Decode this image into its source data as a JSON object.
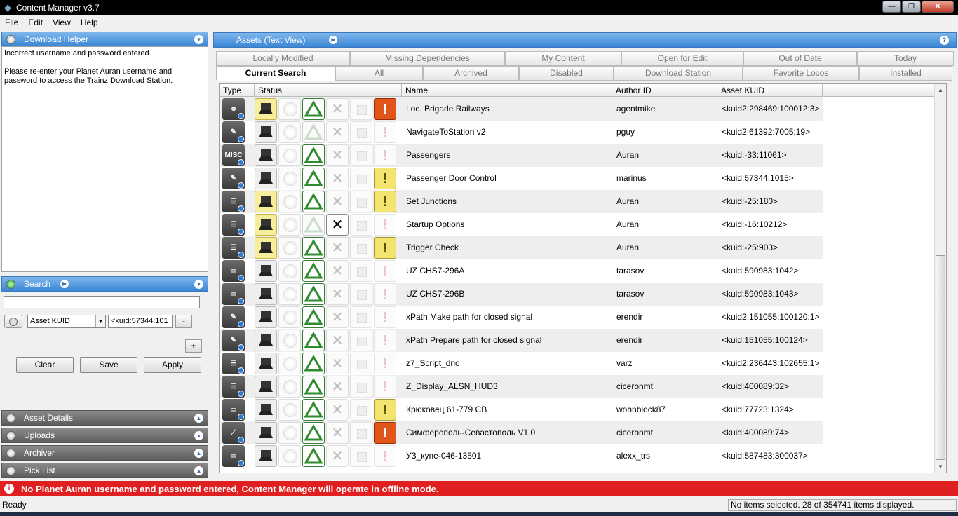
{
  "window": {
    "title": "Content Manager v3.7",
    "min": "—",
    "max": "❐",
    "close": "✕"
  },
  "menu": [
    "File",
    "Edit",
    "View",
    "Help"
  ],
  "download_helper": {
    "title": "Download Helper",
    "message1": "Incorrect username and password entered.",
    "message2": "Please re-enter your Planet Auran username and password to access the Trainz Download Station."
  },
  "search": {
    "title": "Search",
    "field": "Asset KUID",
    "value": "<kuid:57344:101",
    "minus": "-",
    "plus": "+",
    "clear": "Clear",
    "save": "Save",
    "apply": "Apply"
  },
  "panels": [
    "Asset Details",
    "Uploads",
    "Archiver",
    "Pick List"
  ],
  "main": {
    "title": "Assets (Text View)",
    "help": "?"
  },
  "tabs_row1": [
    "Locally Modified",
    "Missing Dependencies",
    "My Content",
    "Open for Edit",
    "Out of Date",
    "Today"
  ],
  "tabs_row2": [
    "Current Search",
    "All",
    "Archived",
    "Disabled",
    "Download Station",
    "Favorite Locos",
    "Installed"
  ],
  "columns": [
    "Type",
    "Status",
    "Name",
    "Author ID",
    "Asset KUID"
  ],
  "rows": [
    {
      "type": "person",
      "name": "Loc. Brigade Railways",
      "author": "agentmike",
      "kuid": "<kuid2:298469:100012:3>"
    },
    {
      "type": "script",
      "name": "NavigateToStation v2",
      "author": "pguy",
      "kuid": "<kuid2:61392:7005:19>"
    },
    {
      "type": "misc",
      "name": "Passengers",
      "author": "Auran",
      "kuid": "<kuid:-33:11061>"
    },
    {
      "type": "script",
      "name": "Passenger Door Control",
      "author": "marinus",
      "kuid": "<kuid:57344:1015>"
    },
    {
      "type": "rule",
      "name": "Set Junctions",
      "author": "Auran",
      "kuid": "<kuid:-25:180>"
    },
    {
      "type": "rule",
      "name": "Startup Options",
      "author": "Auran",
      "kuid": "<kuid:-16:10212>"
    },
    {
      "type": "rule",
      "name": "Trigger Check",
      "author": "Auran",
      "kuid": "<kuid:-25:903>"
    },
    {
      "type": "traincar",
      "name": "UZ CHS7-296A",
      "author": "tarasov",
      "kuid": "<kuid:590983:1042>"
    },
    {
      "type": "traincar",
      "name": "UZ CHS7-296B",
      "author": "tarasov",
      "kuid": "<kuid:590983:1043>"
    },
    {
      "type": "script",
      "name": "xPath Make path for closed signal",
      "author": "erendir",
      "kuid": "<kuid2:151055:100120:1>"
    },
    {
      "type": "script",
      "name": "xPath Prepare path for closed signal",
      "author": "erendir",
      "kuid": "<kuid:151055:100124>"
    },
    {
      "type": "rule",
      "name": "z7_Script_dnc",
      "author": "varz",
      "kuid": "<kuid2:236443:102655:1>"
    },
    {
      "type": "rule",
      "name": "Z_Display_ALSN_HUD3",
      "author": "ciceronmt",
      "kuid": "<kuid:400089:32>"
    },
    {
      "type": "traincar",
      "name": "Крюковец 61-779 CB",
      "author": "wohnblock87",
      "kuid": "<kuid:77723:1324>"
    },
    {
      "type": "track",
      "name": "Симферополь-Севастополь V1.0",
      "author": "ciceronmt",
      "kuid": "<kuid:400089:74>"
    },
    {
      "type": "traincar",
      "name": "УЗ_купе-046-13501",
      "author": "alexx_trs",
      "kuid": "<kuid:587483:300037>"
    }
  ],
  "error_bar": "No Planet Auran username and password entered, Content Manager will operate in offline mode.",
  "status": {
    "left": "Ready",
    "right": "No items selected. 28 of 354741 items displayed."
  }
}
